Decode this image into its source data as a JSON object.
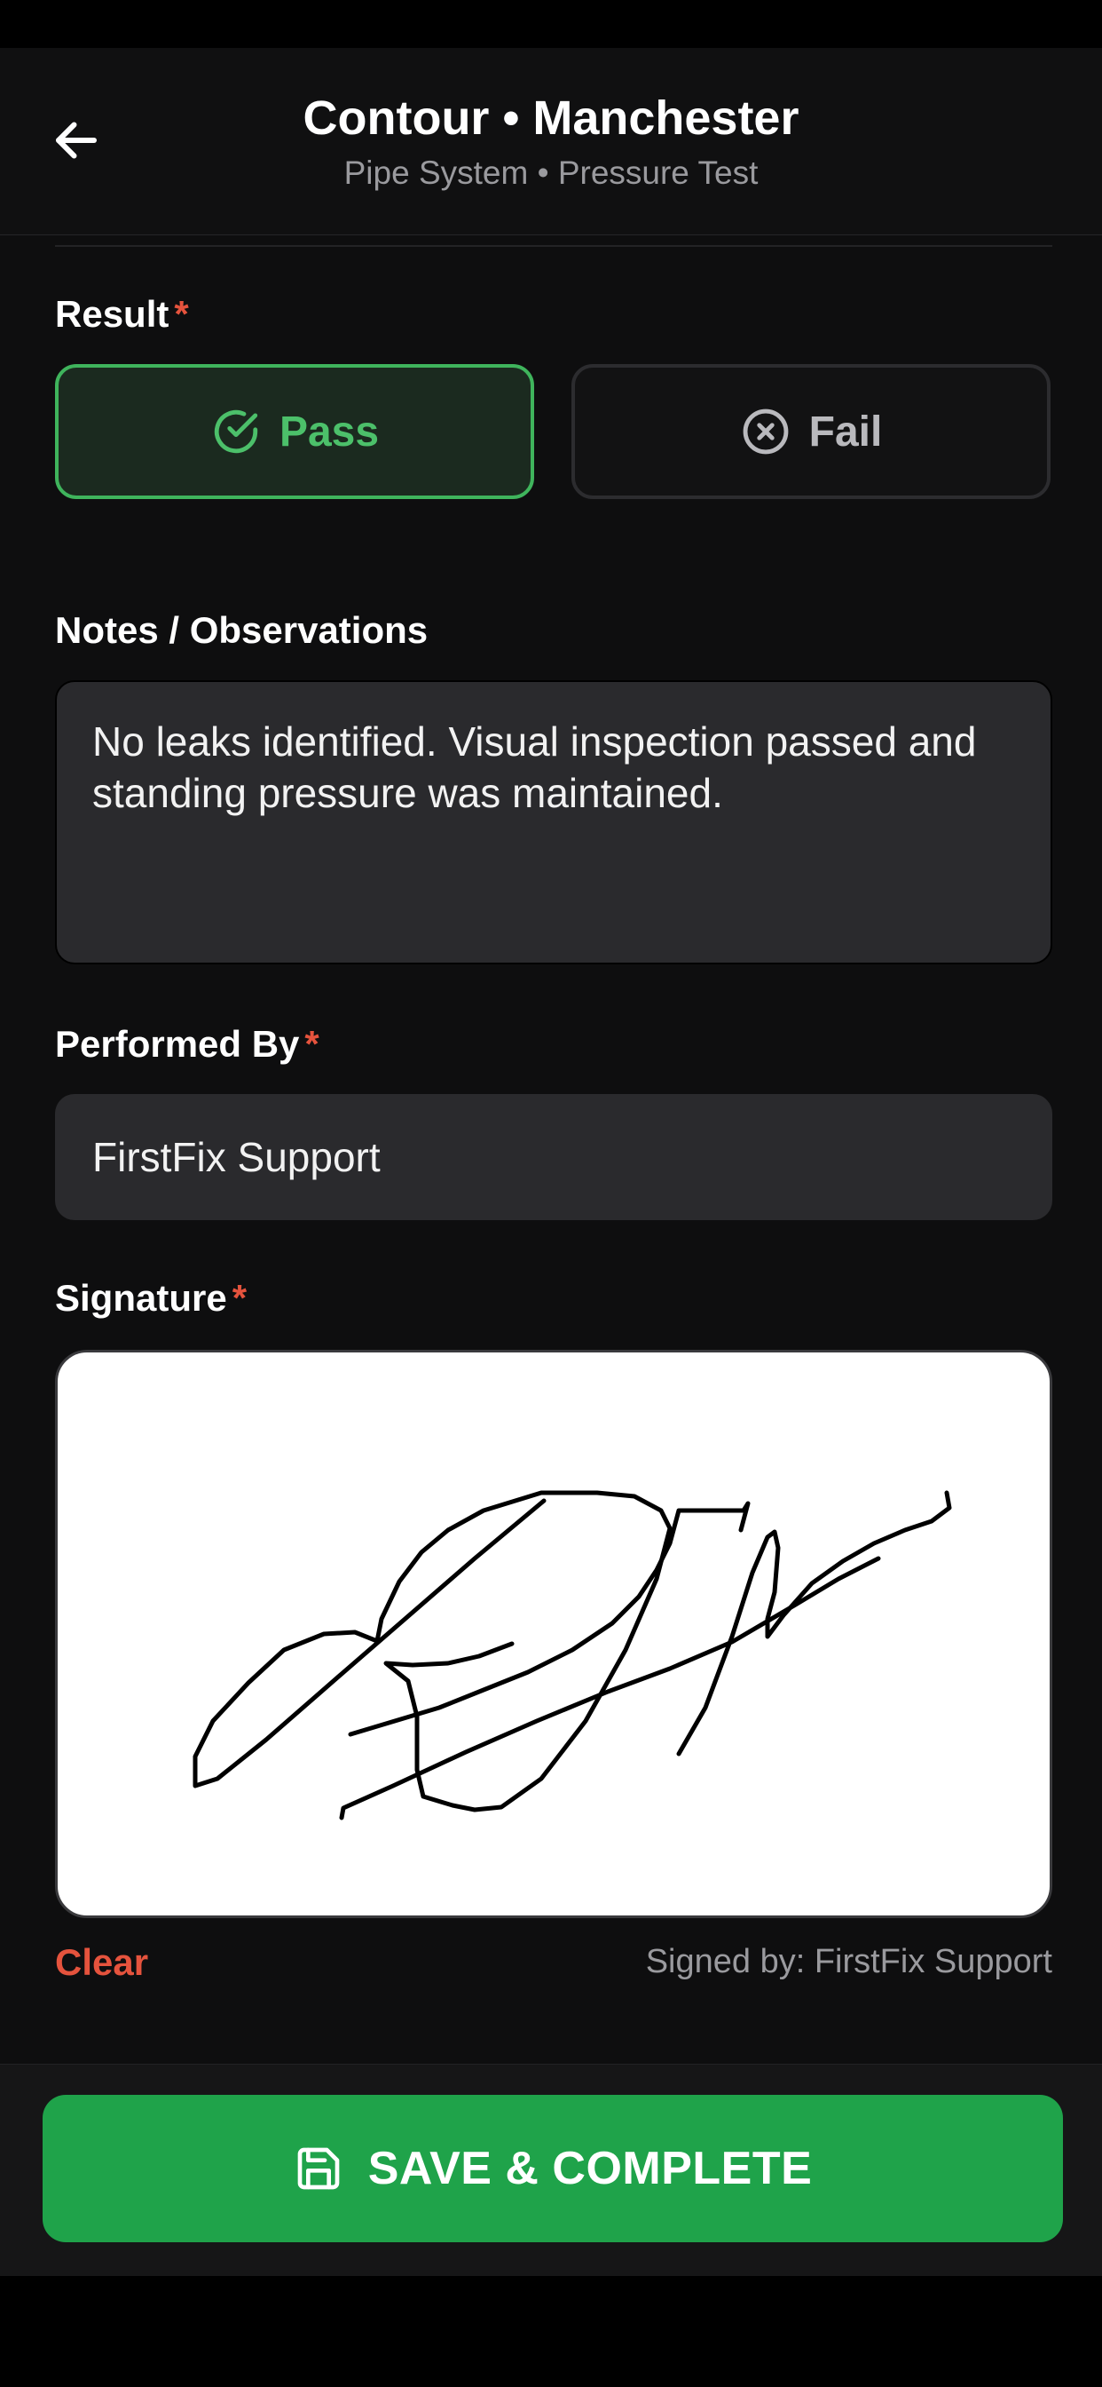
{
  "header": {
    "title": "Contour • Manchester",
    "subtitle": "Pipe System • Pressure Test",
    "back_icon": "arrow-left-icon"
  },
  "result": {
    "label": "Result",
    "required_mark": "*",
    "pass_label": "Pass",
    "fail_label": "Fail",
    "selected": "Pass",
    "pass_color": "#3fb45c",
    "fail_color": "#b9b9bd"
  },
  "notes": {
    "label": "Notes / Observations",
    "value": "No leaks identified. Visual inspection passed and standing pressure was maintained."
  },
  "performed_by": {
    "label": "Performed By",
    "required_mark": "*",
    "value": "FirstFix Support"
  },
  "signature": {
    "label": "Signature",
    "required_mark": "*",
    "clear_label": "Clear",
    "signed_by": "Signed by: FirstFix Support"
  },
  "footer": {
    "save_label": "SAVE & COMPLETE",
    "save_icon": "floppy-disk-icon",
    "accent": "#1fa34a"
  }
}
